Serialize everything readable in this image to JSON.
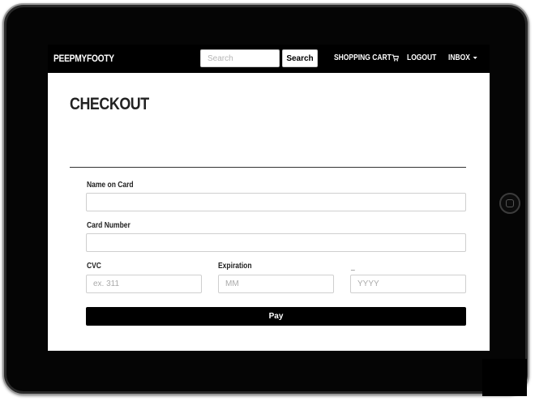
{
  "navbar": {
    "brand": "PEEPMYFOOTY",
    "search_placeholder": "Search",
    "search_button": "Search",
    "cart_label": "SHOPPING CART",
    "logout_label": "LOGOUT",
    "inbox_label": "INBOX"
  },
  "page": {
    "title": "CHECKOUT"
  },
  "form": {
    "name_label": "Name on Card",
    "name_value": "",
    "card_label": "Card Number",
    "card_value": "",
    "cvc_label": "CVC",
    "cvc_placeholder": "ex. 311",
    "expiration_label": "Expiration",
    "month_placeholder": "MM",
    "year_label": "_",
    "year_placeholder": "YYYY",
    "pay_button": "Pay"
  },
  "icons": {
    "cart": "shopping-cart-icon",
    "inbox_dropdown": "caret-down-icon",
    "home": "home-button-icon"
  },
  "colors": {
    "navbar_bg": "#000000",
    "pay_button_bg": "#000000",
    "device_frame": "#050505"
  }
}
